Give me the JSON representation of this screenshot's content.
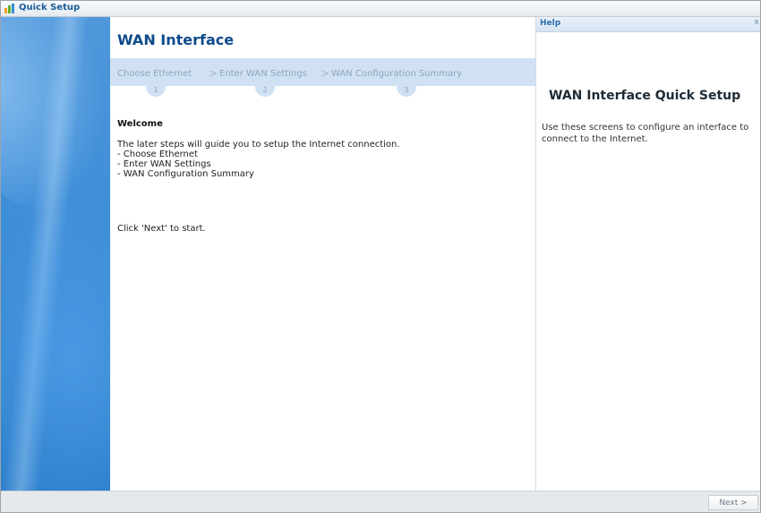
{
  "window": {
    "title": "Quick Setup"
  },
  "main": {
    "title": "WAN Interface",
    "steps": [
      {
        "label": "Choose Ethernet",
        "number": "1"
      },
      {
        "label": "Enter WAN Settings",
        "number": "2"
      },
      {
        "label": "WAN Configuration Summary",
        "number": "3"
      }
    ],
    "separator": ">",
    "welcome_heading": "Welcome",
    "intro_lines": [
      "The later steps will guide you to setup the Internet connection.",
      "- Choose Ethernet",
      "- Enter WAN Settings",
      "- WAN Configuration Summary"
    ],
    "next_hint": "Click 'Next' to start."
  },
  "help": {
    "label": "Help",
    "close": "x",
    "title": "WAN Interface Quick Setup",
    "body": "Use these screens to configure an interface to connect to the Internet."
  },
  "footer": {
    "next_label": "Next >"
  },
  "icons": {
    "app_icon": "quick-setup-icon",
    "close": "close-icon"
  }
}
